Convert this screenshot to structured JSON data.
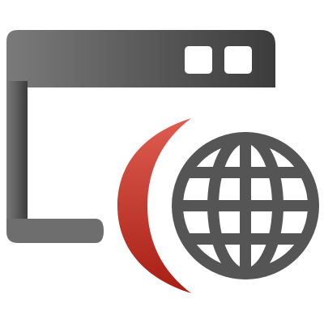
{
  "icon": {
    "name": "web-browser-globe-icon",
    "parts": [
      "window-frame-icon",
      "window-control-squares",
      "globe-icon",
      "globe-shadow-crescent"
    ]
  },
  "colors": {
    "background": "#ffffff",
    "window_dark": "#3f3f3f",
    "window_light": "#777777",
    "control_fill": "#ffffff",
    "globe_stroke": "#555555",
    "crescent_dark": "#b3271c",
    "crescent_light": "#dd5c50"
  }
}
